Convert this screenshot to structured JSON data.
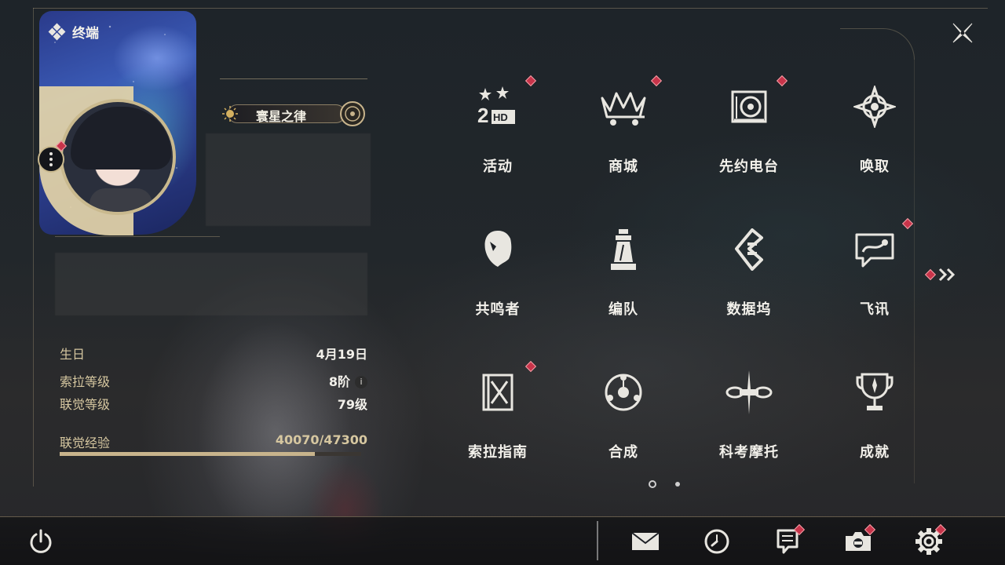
{
  "header": {
    "terminal_label": "终端",
    "terminal_icon": "diamond-cluster-icon",
    "close_icon": "close-x-icon"
  },
  "profile": {
    "title_badge": "寰星之律",
    "avatar_icon": "avatar-portrait",
    "menu_icon": "more-vertical-icon",
    "info": {
      "birthday_label": "生日",
      "birthday_value": "4月19日",
      "sola_level_label": "索拉等级",
      "sola_level_value": "8阶",
      "union_level_label": "联觉等级",
      "union_level_value": "79级",
      "exp_label": "联觉经验",
      "exp_value": "40070/47300",
      "exp_current": 40070,
      "exp_max": 47300
    }
  },
  "menu": {
    "items": [
      {
        "label": "活动",
        "icon": "event-2hd-icon",
        "badge": true
      },
      {
        "label": "商城",
        "icon": "shop-crown-icon",
        "badge": true
      },
      {
        "label": "先约电台",
        "icon": "radio-icon",
        "badge": true
      },
      {
        "label": "唤取",
        "icon": "summon-compass-icon",
        "badge": false
      },
      {
        "label": "共鸣者",
        "icon": "resonator-icon",
        "badge": false
      },
      {
        "label": "编队",
        "icon": "formation-chess-icon",
        "badge": false
      },
      {
        "label": "数据坞",
        "icon": "databank-icon",
        "badge": false
      },
      {
        "label": "飞讯",
        "icon": "message-chat-icon",
        "badge": true
      },
      {
        "label": "索拉指南",
        "icon": "guidebook-icon",
        "badge": true
      },
      {
        "label": "合成",
        "icon": "synthesis-icon",
        "badge": false
      },
      {
        "label": "科考摩托",
        "icon": "motorbike-icon",
        "badge": false
      },
      {
        "label": "成就",
        "icon": "trophy-icon",
        "badge": false
      }
    ],
    "next_page_icon": "double-chevron-right-icon",
    "page_count": 2,
    "current_page": 1
  },
  "bottom_bar": {
    "power_icon": "power-icon",
    "buttons": [
      "mail-icon",
      "clock-icon",
      "notice-icon",
      "camera-icon",
      "settings-gear-icon"
    ]
  },
  "colors": {
    "accent_gold": "#c8b48c",
    "badge_red": "#c8344a",
    "label_gold": "#d6c7a0"
  }
}
